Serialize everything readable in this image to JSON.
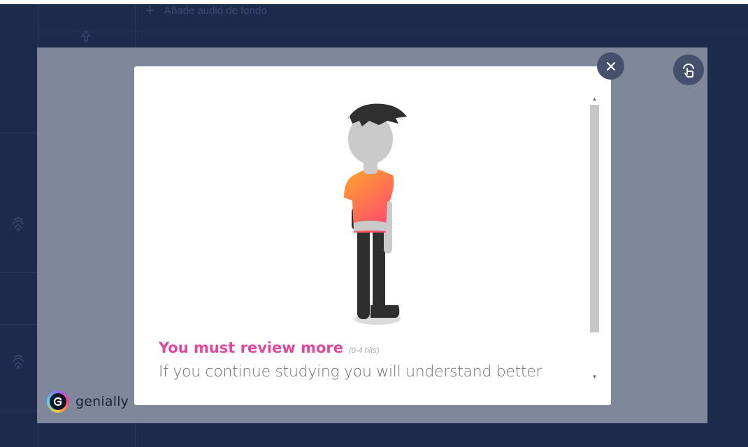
{
  "background": {
    "audio_label": "Añade audio de fondo",
    "plus_icon": "plus-icon",
    "upload_icon": "upload-icon",
    "item_icon": "fingerprint-icon"
  },
  "overlay": {
    "brand_name": "genially",
    "brand_logo_icon": "genially-logo-icon"
  },
  "modal": {
    "illustration": "standing-person-illustration",
    "result_title": "You must review more",
    "result_range": "(0-4 hits)",
    "result_description": "If you continue studying you will understand better",
    "close_icon": "close-icon",
    "corner_icon": "touch-hand-icon"
  },
  "colors": {
    "overlay": "#7f889b",
    "app_background": "#1c2a4c",
    "result_title": "#e3479b",
    "button_background": "#44506c"
  }
}
